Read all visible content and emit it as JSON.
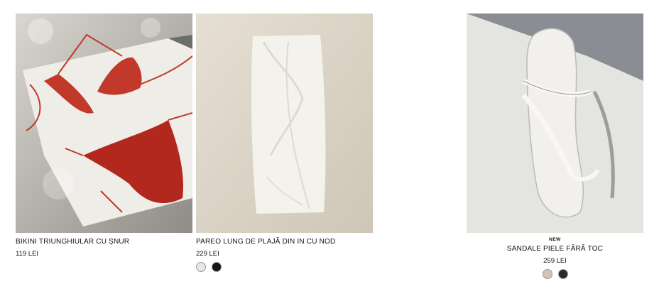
{
  "products": [
    {
      "title": "BIKINI TRIUNGHIULAR CU ȘNUR",
      "price": "119 LEI",
      "image": "red-bikini-photo"
    },
    {
      "title": "PAREO LUNG DE PLAJĂ DIN IN CU NOD",
      "price": "229 LEI",
      "image": "white-linen-pareo-photo",
      "swatches": [
        "#e9e7e1",
        "#151515"
      ]
    },
    {
      "badge": "NEW",
      "title": "SANDALE PIELE FĂRĂ TOC",
      "price": "259 LEI",
      "image": "white-leather-sandal-photo",
      "swatches": [
        "#cfc6b6",
        "#2a2a2a"
      ]
    }
  ]
}
